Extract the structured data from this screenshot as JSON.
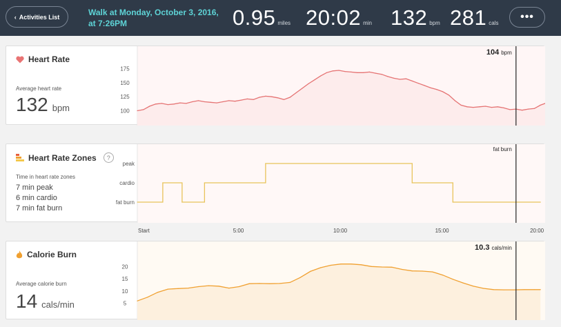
{
  "header": {
    "back_label": "Activities List",
    "title": "Walk at Monday, October 3, 2016, at 7:26PM",
    "stats": [
      {
        "value": "0.95",
        "unit": "miles"
      },
      {
        "value": "20:02",
        "unit": "min"
      },
      {
        "value": "132",
        "unit": "bpm"
      },
      {
        "value": "281",
        "unit": "cals"
      }
    ],
    "more_label": "•••"
  },
  "heart_rate": {
    "title": "Heart Rate",
    "avg_label": "Average heart rate",
    "avg_value": "132",
    "avg_unit": "bpm",
    "cursor_value": "104",
    "cursor_unit": "bpm",
    "color": "#e57373",
    "chart_data": {
      "type": "area",
      "ylabel_ticks": [
        "175",
        "150",
        "125",
        "100"
      ],
      "yticks": [
        175,
        150,
        125,
        100
      ],
      "ylim": [
        92,
        188
      ],
      "xlim": [
        0,
        20.03
      ],
      "x": [
        0,
        0.3,
        0.6,
        0.9,
        1.2,
        1.5,
        1.8,
        2.1,
        2.4,
        2.7,
        3.0,
        3.3,
        3.6,
        3.9,
        4.2,
        4.5,
        4.8,
        5.1,
        5.4,
        5.7,
        6.0,
        6.3,
        6.6,
        6.9,
        7.2,
        7.5,
        7.8,
        8.1,
        8.4,
        8.7,
        9.0,
        9.3,
        9.6,
        9.9,
        10.2,
        10.5,
        10.8,
        11.1,
        11.4,
        11.7,
        12.0,
        12.3,
        12.6,
        12.9,
        13.2,
        13.5,
        13.8,
        14.1,
        14.4,
        14.7,
        15.0,
        15.3,
        15.6,
        15.9,
        16.2,
        16.5,
        16.8,
        17.1,
        17.4,
        17.7,
        18.0,
        18.3,
        18.6,
        18.9,
        19.2,
        19.5,
        19.8,
        20.03
      ],
      "y": [
        100,
        102,
        108,
        112,
        113,
        111,
        112,
        114,
        113,
        116,
        118,
        116,
        115,
        114,
        116,
        118,
        117,
        119,
        121,
        120,
        124,
        126,
        125,
        123,
        120,
        124,
        132,
        140,
        148,
        155,
        162,
        168,
        171,
        172,
        170,
        169,
        168,
        168,
        169,
        167,
        165,
        161,
        158,
        156,
        157,
        153,
        149,
        145,
        141,
        138,
        134,
        128,
        118,
        110,
        107,
        106,
        107,
        108,
        106,
        107,
        105,
        102,
        103,
        101,
        103,
        104,
        110,
        113
      ]
    }
  },
  "hr_zones": {
    "title": "Heart Rate Zones",
    "help_label": "?",
    "desc": "Time in heart rate zones",
    "lines": [
      "7 min peak",
      "6 min cardio",
      "7 min fat burn"
    ],
    "cursor_value": "fat burn",
    "color": "#e8c35a",
    "chart_data": {
      "type": "line",
      "step": true,
      "zones": [
        "fat burn",
        "cardio",
        "peak"
      ],
      "ylabel_ticks": [
        "peak",
        "cardio",
        "fat burn"
      ],
      "xlim": [
        0,
        20.03
      ],
      "x": [
        0,
        1.25,
        1.25,
        2.2,
        2.2,
        3.3,
        3.3,
        6.3,
        6.3,
        13.5,
        13.5,
        15.5,
        15.5,
        19.8
      ],
      "y": [
        "fat burn",
        "fat burn",
        "cardio",
        "cardio",
        "fat burn",
        "fat burn",
        "cardio",
        "cardio",
        "peak",
        "peak",
        "cardio",
        "cardio",
        "fat burn",
        "fat burn"
      ]
    }
  },
  "time_axis": {
    "xticks": [
      0,
      5,
      10,
      15,
      20
    ],
    "xlabel_ticks": [
      "Start",
      "5:00",
      "10:00",
      "15:00",
      "20:00"
    ]
  },
  "calorie": {
    "title": "Calorie Burn",
    "avg_label": "Average calorie burn",
    "avg_value": "14",
    "avg_unit": "cals/min",
    "cursor_value": "10.3",
    "cursor_unit": "cals/min",
    "color": "#f0a030",
    "chart_data": {
      "type": "area",
      "ylabel_ticks": [
        "20",
        "15",
        "10",
        "5"
      ],
      "yticks": [
        20,
        15,
        10,
        5
      ],
      "ylim": [
        1,
        24
      ],
      "xlim": [
        0,
        20.03
      ],
      "x": [
        0,
        0.5,
        1.0,
        1.5,
        2.0,
        2.5,
        3.0,
        3.5,
        4.0,
        4.5,
        5.0,
        5.5,
        6.0,
        6.5,
        7.0,
        7.5,
        8.0,
        8.5,
        9.0,
        9.5,
        10.0,
        10.5,
        11.0,
        11.5,
        12.0,
        12.5,
        13.0,
        13.5,
        14.0,
        14.5,
        15.0,
        15.5,
        16.0,
        16.5,
        17.0,
        17.5,
        18.0,
        18.5,
        19.0,
        19.5,
        19.8
      ],
      "y": [
        6,
        7.5,
        9.5,
        10.8,
        11,
        11.2,
        11.8,
        12.2,
        12,
        11.2,
        11.8,
        13,
        13.1,
        13,
        13.1,
        13.5,
        15.5,
        18,
        19.5,
        20.5,
        21,
        21,
        20.7,
        20,
        19.8,
        19.7,
        18.8,
        18.2,
        18.1,
        17.8,
        16.5,
        14.8,
        13.3,
        12,
        11.1,
        10.6,
        10.5,
        10.5,
        10.6,
        10.6,
        10.6
      ]
    }
  }
}
